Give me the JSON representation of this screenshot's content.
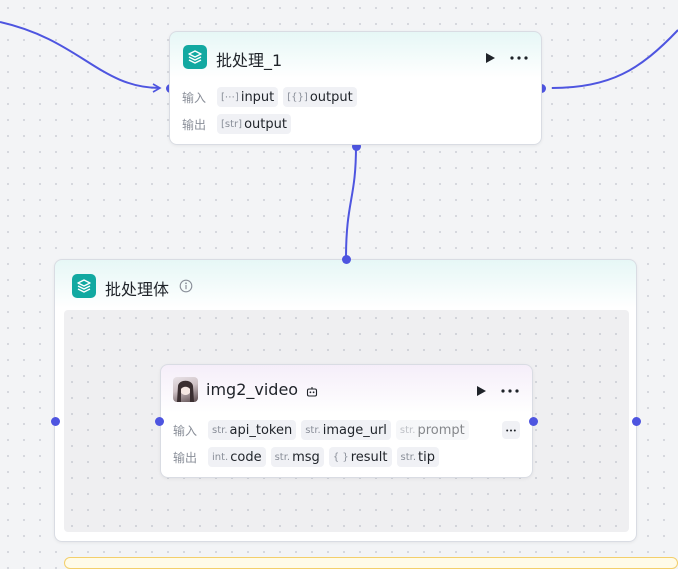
{
  "colors": {
    "edge": "#4e55e0",
    "node_icon": "#12a9a1"
  },
  "batch_node": {
    "title": "批处理_1",
    "icon": "layers-icon",
    "input_label": "输入",
    "output_label": "输出",
    "inputs": [
      {
        "type": "[⋯]",
        "name": "input"
      },
      {
        "type": "[{}]",
        "name": "output"
      }
    ],
    "outputs": [
      {
        "type": "[str]",
        "name": "output"
      }
    ]
  },
  "batch_body": {
    "title": "批处理体",
    "icon": "layers-icon",
    "info_icon": "info-icon"
  },
  "inner_node": {
    "title": "img2_video",
    "icon": "avatar-image",
    "badge_icon": "bot-icon",
    "input_label": "输入",
    "output_label": "输出",
    "inputs": [
      {
        "type": "str.",
        "name": "api_token"
      },
      {
        "type": "str.",
        "name": "image_url"
      },
      {
        "type": "str.",
        "name": "prompt"
      }
    ],
    "outputs": [
      {
        "type": "int.",
        "name": "code"
      },
      {
        "type": "str.",
        "name": "msg"
      },
      {
        "type": "{ }",
        "name": "result"
      },
      {
        "type": "str.",
        "name": "tip"
      }
    ]
  }
}
